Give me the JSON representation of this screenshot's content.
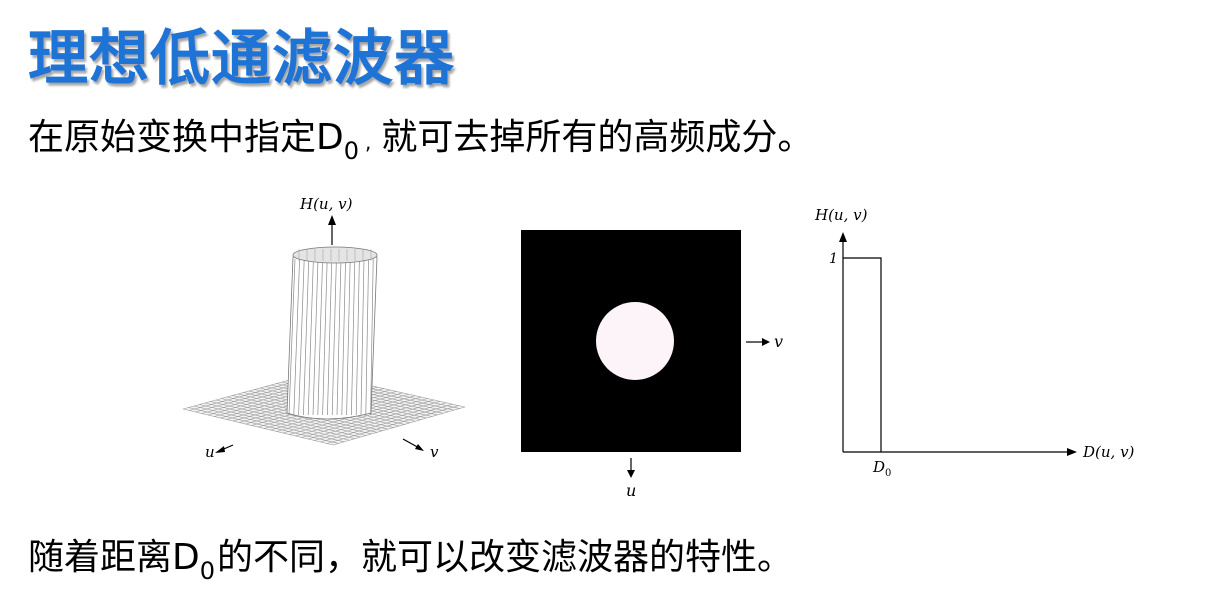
{
  "slide": {
    "title": "理想低通滤波器",
    "line1": {
      "before": "在原始变换中指定D",
      "subscript": "0",
      "comma": ",",
      "after": "就可去掉所有的高频成分。"
    },
    "line2": {
      "before": "随着距离D",
      "subscript": "0",
      "after": "的不同，就可以改变滤波器的特性。"
    },
    "title_color": "#1e73d6"
  },
  "figure_surface": {
    "z_label": "H(u, v)",
    "u_label": "u",
    "v_label": "v"
  },
  "figure_image": {
    "v_label": "v",
    "u_label": "u"
  },
  "figure_profile": {
    "y_label": "H(u, v)",
    "y_tick": "1",
    "x_label": "D(u, v)",
    "d0_label": "D",
    "d0_sub": "0"
  }
}
